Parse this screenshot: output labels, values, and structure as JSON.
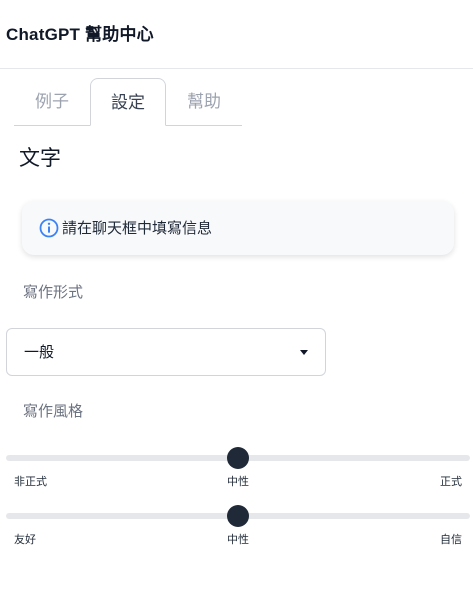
{
  "header": {
    "title": "ChatGPT 幫助中心"
  },
  "tabs": [
    {
      "label": "例子",
      "active": false
    },
    {
      "label": "設定",
      "active": true
    },
    {
      "label": "幫助",
      "active": false
    }
  ],
  "section": {
    "title": "文字"
  },
  "info": {
    "icon": "info-icon",
    "text": "請在聊天框中填寫信息",
    "accent": "#3b82f6"
  },
  "writing_form": {
    "label": "寫作形式",
    "selected": "一般"
  },
  "writing_style": {
    "label": "寫作風格",
    "sliders": [
      {
        "left": "非正式",
        "middle": "中性",
        "right": "正式",
        "value": 0.5
      },
      {
        "left": "友好",
        "middle": "中性",
        "right": "自信",
        "value": 0.5
      }
    ]
  },
  "colors": {
    "thumb": "#1f2937",
    "track": "#e5e7eb"
  }
}
